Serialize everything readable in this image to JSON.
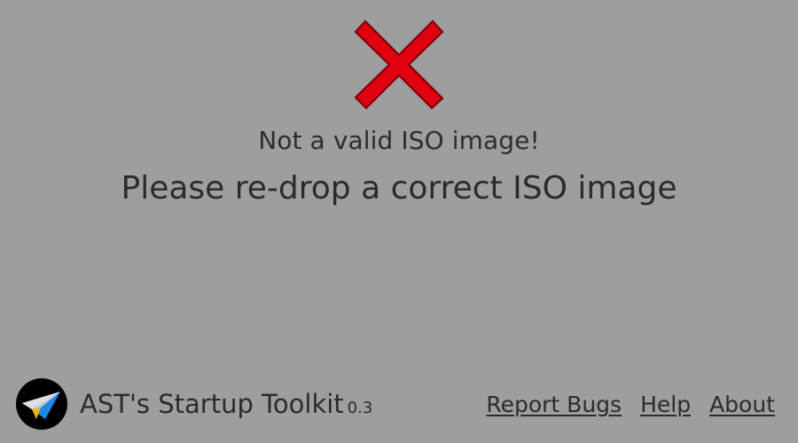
{
  "error": {
    "icon": "close-icon",
    "title": "Not a valid ISO image!",
    "subtitle": "Please re-drop a correct ISO image",
    "icon_color": "#e0000f",
    "icon_outline": "#7f0008"
  },
  "footer": {
    "logo_icon": "paper-plane-icon",
    "app_name": "AST's Startup Toolkit",
    "version": "0.3",
    "links": {
      "report_bugs": "Report Bugs",
      "help": "Help",
      "about": "About"
    }
  },
  "colors": {
    "background": "#9e9e9e",
    "text": "#2b2b2b",
    "logo_background": "#000000",
    "logo_blue": "#1e88e5",
    "logo_yellow": "#ffb300"
  }
}
